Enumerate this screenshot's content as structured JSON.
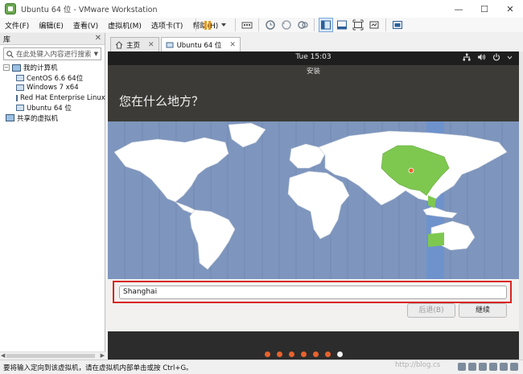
{
  "window": {
    "title": "Ubuntu 64 位 - VMware Workstation",
    "controls": [
      "—",
      "☐",
      "✕"
    ]
  },
  "menu": [
    "文件(F)",
    "编辑(E)",
    "查看(V)",
    "虚拟机(M)",
    "选项卡(T)",
    "帮助(H)"
  ],
  "library": {
    "title": "库",
    "close": "✕",
    "search_placeholder": "在此处键入内容进行搜索",
    "root": "我的计算机",
    "vms": [
      "CentOS 6.6 64位",
      "Windows 7 x64",
      "Red Hat Enterprise Linux",
      "Ubuntu 64 位"
    ],
    "shared": "共享的虚拟机"
  },
  "tabs": [
    {
      "label": "主页"
    },
    {
      "label": "Ubuntu 64 位"
    }
  ],
  "vm": {
    "clock": "Tue 15:03",
    "installer_title": "安装",
    "question": "您在什么地方？",
    "location_value": "Shanghai",
    "back_label": "后退(B)",
    "continue_label": "继续",
    "progress_total": 7,
    "progress_current": 7
  },
  "status": {
    "text": "要将输入定向到该虚拟机，请在虚拟机内部单击或按 Ctrl+G。"
  },
  "watermark": "http://blog.cs",
  "colors": {
    "map_ocean": "#7e96be",
    "map_land": "#ffffff",
    "selected_region": "#7ec850",
    "timezone_band": "#6e92cc",
    "progress_dot": "#e8622c",
    "highlight_frame": "#d9251d"
  },
  "icons": [
    "vmware-icon",
    "pause-icon",
    "snapshot-icon",
    "fullscreen-icon",
    "network-icon",
    "volume-icon",
    "power-icon",
    "search-icon",
    "home-icon",
    "vm-tab-icon"
  ]
}
